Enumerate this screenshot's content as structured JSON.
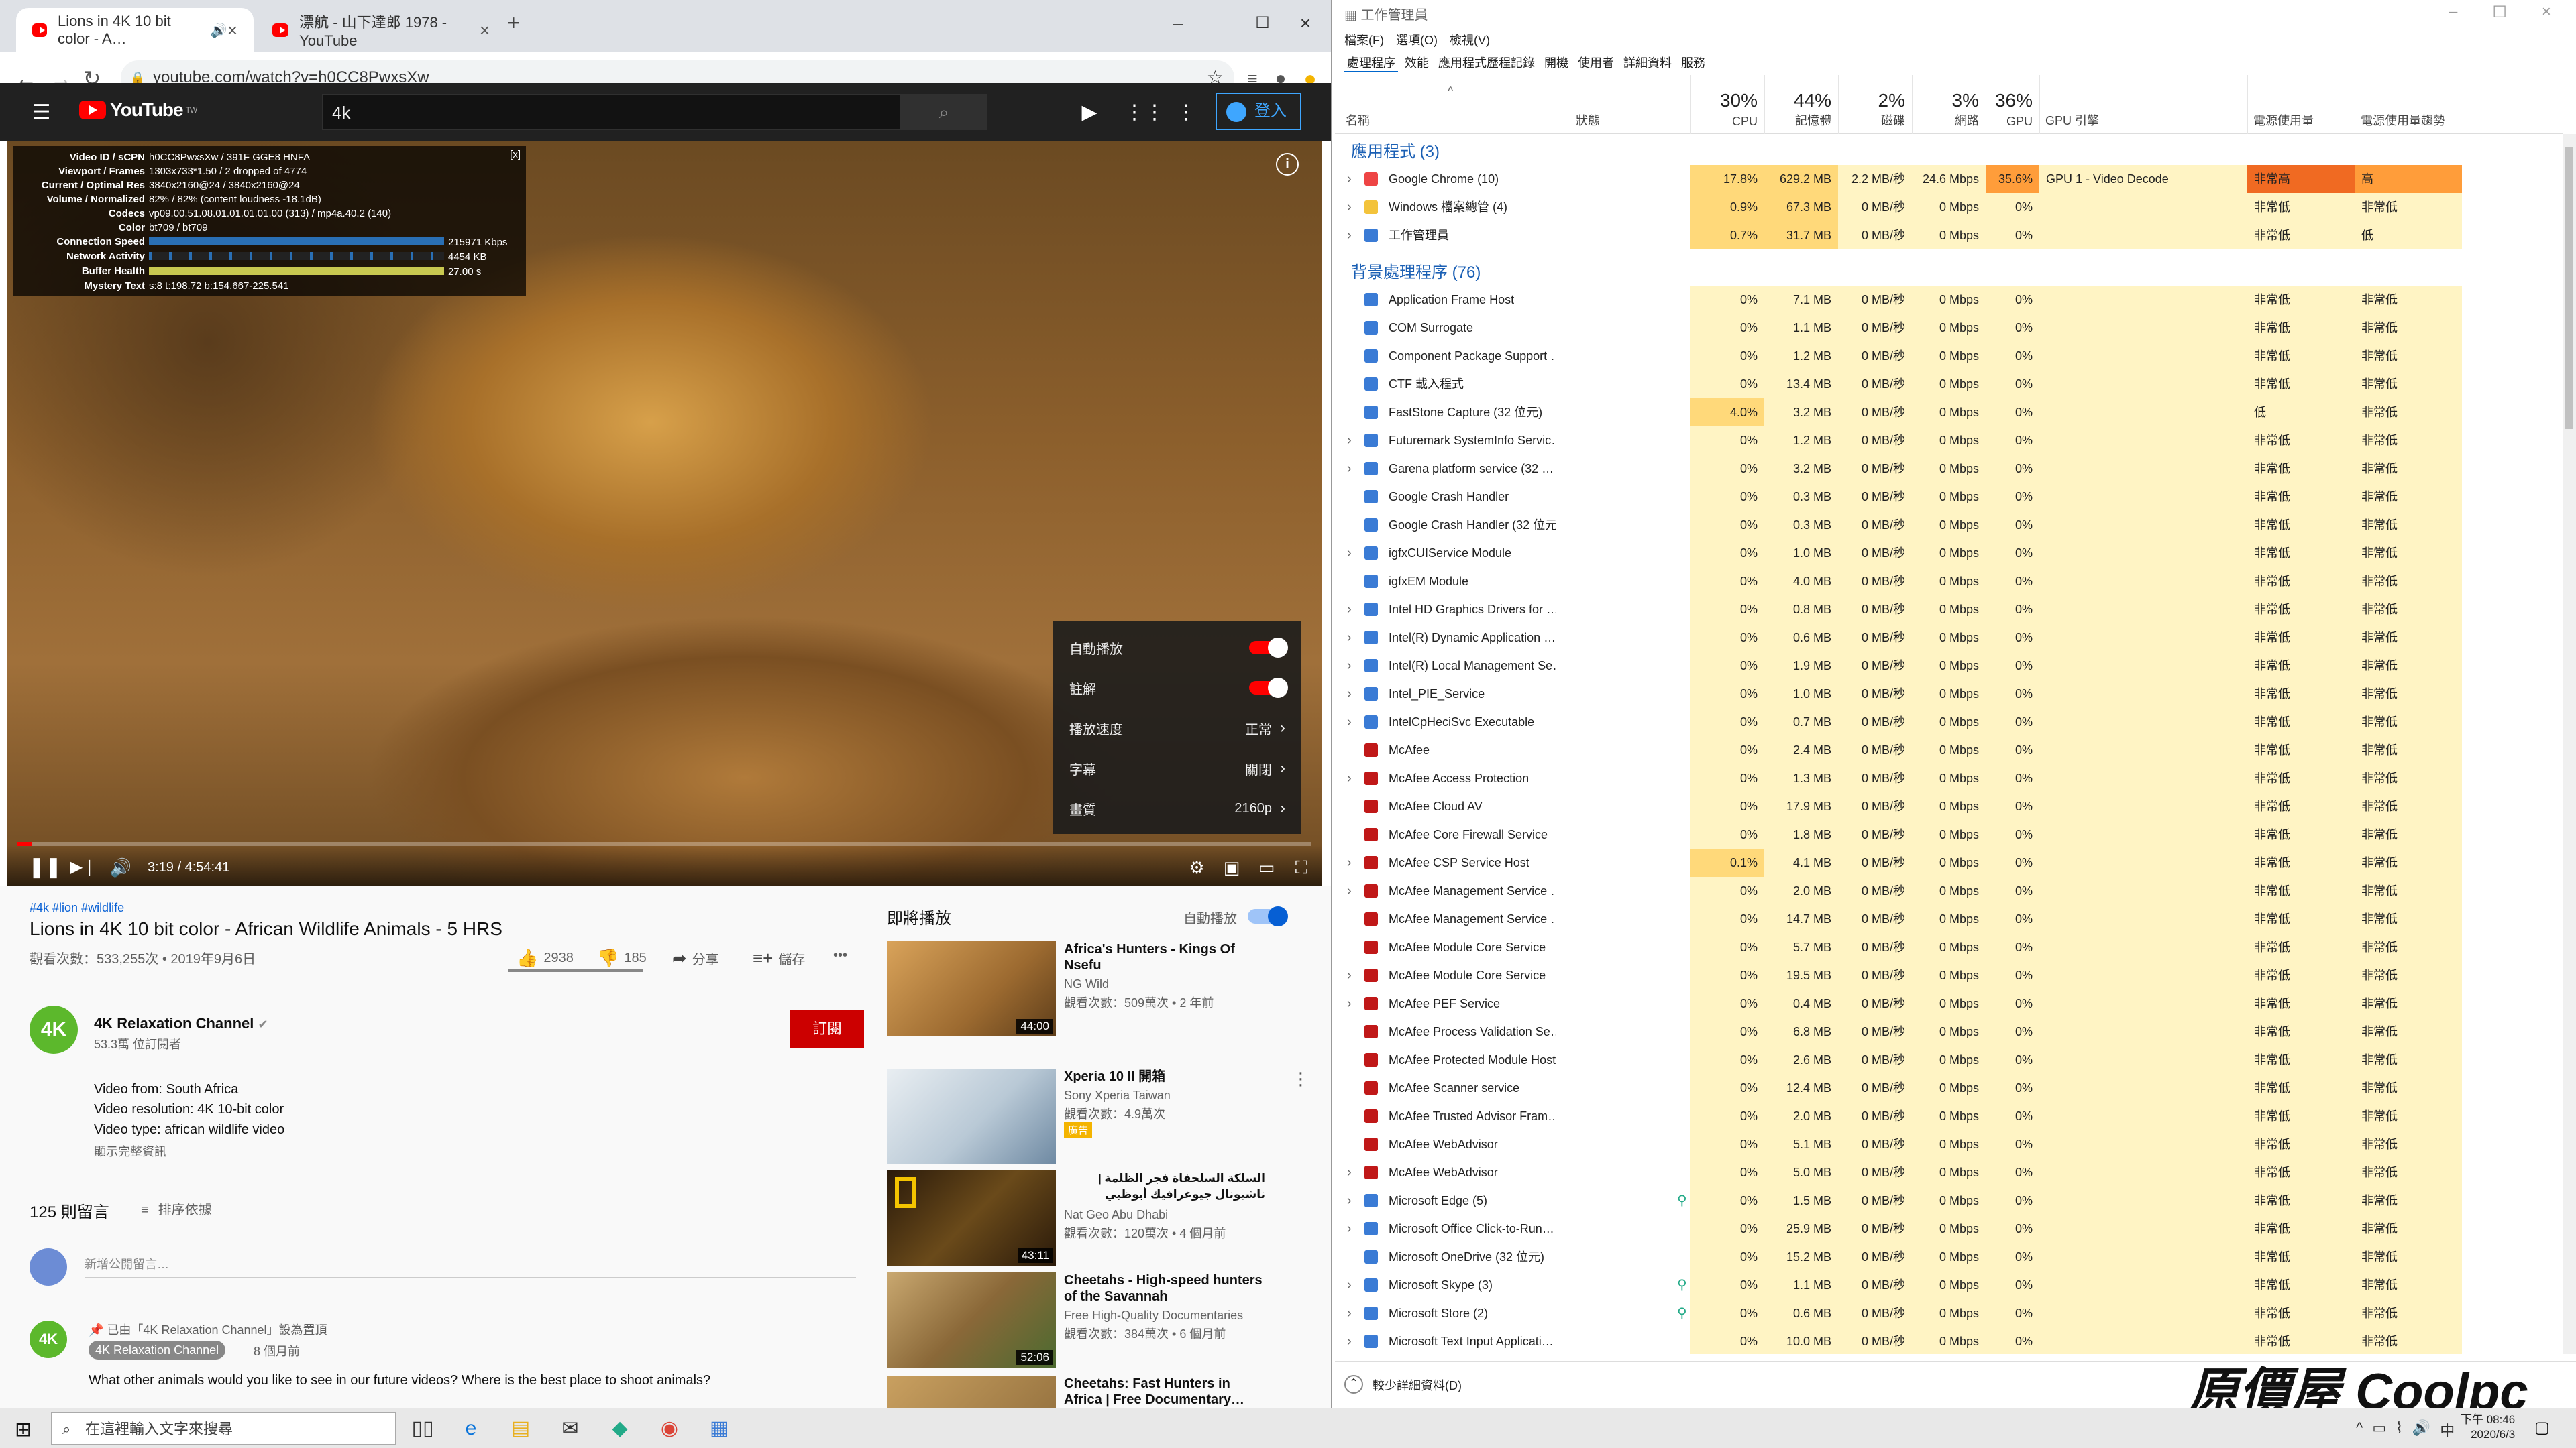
{
  "chrome": {
    "tabs": [
      {
        "label": "Lions in 4K 10 bit color - A…"
      },
      {
        "label": "漂航 - 山下達郎 1978 - YouTube"
      }
    ],
    "new_tab_label": "+",
    "url": "youtube.com/watch?v=h0CC8PwxsXw"
  },
  "youtube": {
    "logo_text": "YouTube",
    "logo_sup": "TW",
    "search_value": "4k",
    "signin_label": "登入",
    "stats": [
      {
        "k": "Video ID / sCPN",
        "v": "h0CC8PwxsXw / 391F GGE8 HNFA"
      },
      {
        "k": "Viewport / Frames",
        "v": "1303x733*1.50 / 2 dropped of 4774"
      },
      {
        "k": "Current / Optimal Res",
        "v": "3840x2160@24 / 3840x2160@24"
      },
      {
        "k": "Volume / Normalized",
        "v": "82% / 82% (content loudness -18.1dB)"
      },
      {
        "k": "Codecs",
        "v": "vp09.00.51.08.01.01.01.01.00 (313) / mp4a.40.2 (140)"
      },
      {
        "k": "Color",
        "v": "bt709 / bt709"
      },
      {
        "k": "Connection Speed",
        "v": "215971 Kbps"
      },
      {
        "k": "Network Activity",
        "v": "4454 KB"
      },
      {
        "k": "Buffer Health",
        "v": "27.00 s"
      },
      {
        "k": "Mystery Text",
        "v": "s:8 t:198.72 b:154.667-225.541"
      }
    ],
    "stats_close": "[x]",
    "settings": [
      {
        "label": "自動播放",
        "value": ""
      },
      {
        "label": "註解",
        "value": ""
      },
      {
        "label": "播放速度",
        "value": "正常"
      },
      {
        "label": "字幕",
        "value": "關閉"
      },
      {
        "label": "畫質",
        "value": "2160p"
      }
    ],
    "time": "3:19 / 4:54:41",
    "progress": 0.011,
    "hashtags": "#4k #lion #wildlife",
    "title": "Lions in 4K 10 bit color - African Wildlife Animals - 5 HRS",
    "views_line": "觀看次數：533,255次 • 2019年9月6日",
    "likes": "2938",
    "dislikes": "185",
    "share": "分享",
    "save": "儲存",
    "more": "•••",
    "channel_avatar": "4K",
    "channel_name": "4K Relaxation Channel",
    "subscribers": "53.3萬 位訂閱者",
    "subscribe": "訂閱",
    "desc1": "Video from: South Africa",
    "desc2": "Video resolution: 4K 10-bit color",
    "desc3": "Video type: african wildlife video",
    "show_more": "顯示完整資訊",
    "comment_count": "125 則留言",
    "sort": "排序依據",
    "comment_placeholder": "新增公開留言…",
    "pinned": "已由「4K Relaxation Channel」設為置頂",
    "comment_author": "4K Relaxation Channel",
    "comment_ago": "8 個月前",
    "comment_text": "What other animals would you like to see in our future videos? Where is the best place to shoot animals?",
    "upnext": "即將播放",
    "autoplay": "自動播放",
    "recs": [
      {
        "title": "Africa's Hunters - Kings Of Nsefu",
        "channel": "NG Wild",
        "meta": "觀看次數：509萬次 • 2 年前",
        "dur": "44:00",
        "ad": ""
      },
      {
        "title": "Xperia 10 II 開箱",
        "channel": "Sony Xperia Taiwan",
        "meta": "觀看次數：4.9萬次",
        "dur": "",
        "ad": "廣告"
      },
      {
        "title": "السلكة السلحفاة فجر الظلمة | ناشيونال جيوغرافيك أبوظبي",
        "channel": "Nat Geo Abu Dhabi",
        "meta": "觀看次數：120萬次 • 4 個月前",
        "dur": "43:11",
        "ad": ""
      },
      {
        "title": "Cheetahs - High-speed hunters of the Savannah",
        "channel": "Free High-Quality Documentaries",
        "meta": "觀看次數：384萬次 • 6 個月前",
        "dur": "52:06",
        "ad": ""
      },
      {
        "title": "Cheetahs: Fast Hunters in Africa | Free Documentary…",
        "channel": "",
        "meta": "",
        "dur": "",
        "ad": ""
      }
    ]
  },
  "taskmgr": {
    "title": "工作管理員",
    "menu": [
      "檔案(F)",
      "選項(O)",
      "檢視(V)"
    ],
    "tabs": [
      "處理程序",
      "效能",
      "應用程式歷程記錄",
      "開機",
      "使用者",
      "詳細資料",
      "服務"
    ],
    "columns": {
      "name": "名稱",
      "status": "狀態",
      "cpu_pct": "30%",
      "cpu": "CPU",
      "mem_pct": "44%",
      "mem": "記憶體",
      "disk_pct": "2%",
      "disk": "磁碟",
      "net_pct": "3%",
      "net": "網路",
      "gpu_pct": "36%",
      "gpu": "GPU",
      "gpu_engine": "GPU 引擎",
      "power": "電源使用量",
      "power_trend": "電源使用量趨勢"
    },
    "group_apps": "應用程式 (3)",
    "group_bg": "背景處理程序 (76)",
    "apps": [
      {
        "name": "Google Chrome (10)",
        "cpu": "17.8%",
        "mem": "629.2 MB",
        "disk": "2.2 MB/秒",
        "net": "24.6 Mbps",
        "gpu": "35.6%",
        "engine": "GPU 1 - Video Decode",
        "power": "非常高",
        "trend": "高",
        "exp": true,
        "color": "#e44"
      },
      {
        "name": "Windows 檔案總管 (4)",
        "cpu": "0.9%",
        "mem": "67.3 MB",
        "disk": "0 MB/秒",
        "net": "0 Mbps",
        "gpu": "0%",
        "engine": "",
        "power": "非常低",
        "trend": "非常低",
        "exp": true,
        "color": "#f3c33b"
      },
      {
        "name": "工作管理員",
        "cpu": "0.7%",
        "mem": "31.7 MB",
        "disk": "0 MB/秒",
        "net": "0 Mbps",
        "gpu": "0%",
        "engine": "",
        "power": "非常低",
        "trend": "低",
        "exp": true,
        "color": "#3a7bd5"
      }
    ],
    "bg": [
      {
        "name": "Application Frame Host",
        "cpu": "0%",
        "mem": "7.1 MB",
        "exp": false
      },
      {
        "name": "COM Surrogate",
        "cpu": "0%",
        "mem": "1.1 MB",
        "exp": false
      },
      {
        "name": "Component Package Support …",
        "cpu": "0%",
        "mem": "1.2 MB",
        "exp": false
      },
      {
        "name": "CTF 載入程式",
        "cpu": "0%",
        "mem": "13.4 MB",
        "exp": false
      },
      {
        "name": "FastStone Capture (32 位元)",
        "cpu": "4.0%",
        "mem": "3.2 MB",
        "exp": false,
        "power": "低"
      },
      {
        "name": "Futuremark SystemInfo Servic…",
        "cpu": "0%",
        "mem": "1.2 MB",
        "exp": true
      },
      {
        "name": "Garena platform service (32 …",
        "cpu": "0%",
        "mem": "3.2 MB",
        "exp": true
      },
      {
        "name": "Google Crash Handler",
        "cpu": "0%",
        "mem": "0.3 MB",
        "exp": false
      },
      {
        "name": "Google Crash Handler (32 位元)",
        "cpu": "0%",
        "mem": "0.3 MB",
        "exp": false
      },
      {
        "name": "igfxCUIService Module",
        "cpu": "0%",
        "mem": "1.0 MB",
        "exp": true
      },
      {
        "name": "igfxEM Module",
        "cpu": "0%",
        "mem": "4.0 MB",
        "exp": false
      },
      {
        "name": "Intel HD Graphics Drivers for …",
        "cpu": "0%",
        "mem": "0.8 MB",
        "exp": true
      },
      {
        "name": "Intel(R) Dynamic Application …",
        "cpu": "0%",
        "mem": "0.6 MB",
        "exp": true
      },
      {
        "name": "Intel(R) Local Management Se…",
        "cpu": "0%",
        "mem": "1.9 MB",
        "exp": true
      },
      {
        "name": "Intel_PIE_Service",
        "cpu": "0%",
        "mem": "1.0 MB",
        "exp": true
      },
      {
        "name": "IntelCpHeciSvc Executable",
        "cpu": "0%",
        "mem": "0.7 MB",
        "exp": true
      },
      {
        "name": "McAfee",
        "cpu": "0%",
        "mem": "2.4 MB",
        "exp": false
      },
      {
        "name": "McAfee Access Protection",
        "cpu": "0%",
        "mem": "1.3 MB",
        "exp": true
      },
      {
        "name": "McAfee Cloud AV",
        "cpu": "0%",
        "mem": "17.9 MB",
        "exp": false
      },
      {
        "name": "McAfee Core Firewall Service",
        "cpu": "0%",
        "mem": "1.8 MB",
        "exp": false
      },
      {
        "name": "McAfee CSP Service Host",
        "cpu": "0.1%",
        "mem": "4.1 MB",
        "exp": true
      },
      {
        "name": "McAfee Management Service …",
        "cpu": "0%",
        "mem": "2.0 MB",
        "exp": true
      },
      {
        "name": "McAfee Management Service …",
        "cpu": "0%",
        "mem": "14.7 MB",
        "exp": false
      },
      {
        "name": "McAfee Module Core Service",
        "cpu": "0%",
        "mem": "5.7 MB",
        "exp": false
      },
      {
        "name": "McAfee Module Core Service",
        "cpu": "0%",
        "mem": "19.5 MB",
        "exp": true
      },
      {
        "name": "McAfee PEF Service",
        "cpu": "0%",
        "mem": "0.4 MB",
        "exp": true
      },
      {
        "name": "McAfee Process Validation Se…",
        "cpu": "0%",
        "mem": "6.8 MB",
        "exp": false
      },
      {
        "name": "McAfee Protected Module Host",
        "cpu": "0%",
        "mem": "2.6 MB",
        "exp": false
      },
      {
        "name": "McAfee Scanner service",
        "cpu": "0%",
        "mem": "12.4 MB",
        "exp": false
      },
      {
        "name": "McAfee Trusted Advisor Fram…",
        "cpu": "0%",
        "mem": "2.0 MB",
        "exp": false
      },
      {
        "name": "McAfee WebAdvisor",
        "cpu": "0%",
        "mem": "5.1 MB",
        "exp": false
      },
      {
        "name": "McAfee WebAdvisor",
        "cpu": "0%",
        "mem": "5.0 MB",
        "exp": true
      },
      {
        "name": "Microsoft Edge (5)",
        "cpu": "0%",
        "mem": "1.5 MB",
        "exp": true,
        "leaf": true
      },
      {
        "name": "Microsoft Office Click-to-Run…",
        "cpu": "0%",
        "mem": "25.9 MB",
        "exp": true
      },
      {
        "name": "Microsoft OneDrive (32 位元)",
        "cpu": "0%",
        "mem": "15.2 MB",
        "exp": false
      },
      {
        "name": "Microsoft Skype (3)",
        "cpu": "0%",
        "mem": "1.1 MB",
        "exp": true,
        "leaf": true
      },
      {
        "name": "Microsoft Store (2)",
        "cpu": "0%",
        "mem": "0.6 MB",
        "exp": true,
        "leaf": true
      },
      {
        "name": "Microsoft Text Input Applicati…",
        "cpu": "0%",
        "mem": "10.0 MB",
        "exp": true
      }
    ],
    "bg_disk": "0 MB/秒",
    "bg_net": "0 Mbps",
    "bg_gpu": "0%",
    "bg_power": "非常低",
    "footer": "較少詳細資料(D)"
  },
  "watermark": "原價屋 Coolpc",
  "taskbar": {
    "search_placeholder": "在這裡輸入文字來搜尋",
    "time": "下午 08:46",
    "date": "2020/6/3",
    "ime": "中"
  }
}
